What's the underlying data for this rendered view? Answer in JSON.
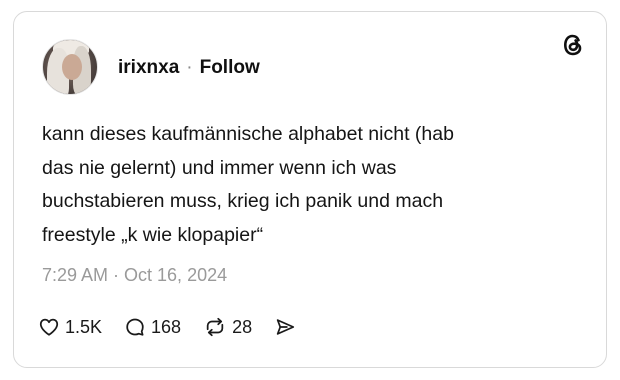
{
  "user": {
    "username": "irixnxa",
    "separator": "·",
    "follow_label": "Follow"
  },
  "post": {
    "text": "kann dieses kaufmännische alphabet nicht (hab\ndas nie gelernt) und immer wenn ich was\nbuchstabieren muss, krieg ich panik und mach\nfreestyle „k wie klopapier“",
    "timestamp": "7:29 AM · Oct 16, 2024"
  },
  "actions": {
    "likes": "1.5K",
    "replies": "168",
    "reposts": "28"
  },
  "icons": {
    "brand": "threads-logo-icon",
    "like": "heart-icon",
    "reply": "comment-bubble-icon",
    "repost": "repost-icon",
    "share": "send-icon"
  },
  "colors": {
    "text": "#101010",
    "muted": "#9a9a9a",
    "border": "#d9d9d9"
  }
}
